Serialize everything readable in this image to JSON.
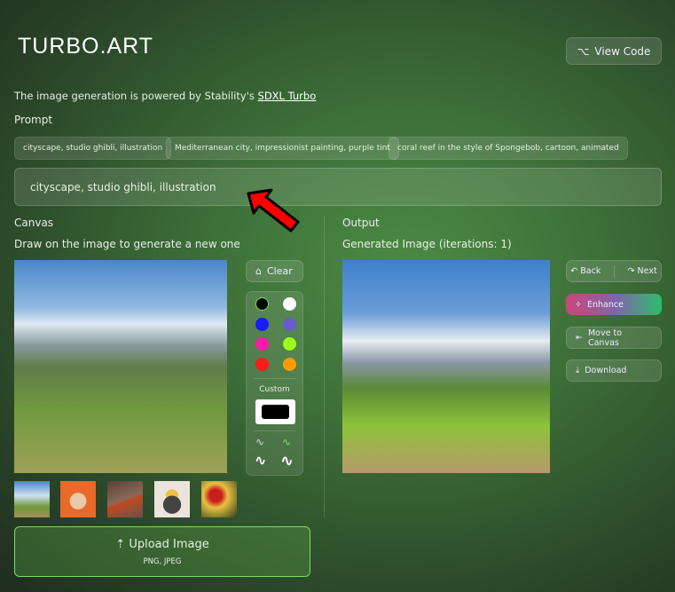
{
  "header": {
    "logo": "TURBO.ART",
    "view_code": "View Code"
  },
  "powered": {
    "text": "The image generation is powered by Stability's ",
    "link": "SDXL Turbo"
  },
  "prompt": {
    "label": "Prompt",
    "suggestions": [
      "cityscape, studio ghibli, illustration",
      "Mediterranean city, impressionist painting, purple tint",
      "coral reef in the style of Spongebob, cartoon, animated"
    ],
    "value": "cityscape, studio ghibli, illustration"
  },
  "canvas": {
    "title": "Canvas",
    "subtitle": "Draw on the image to generate a new one",
    "clear": "Clear",
    "colors": [
      "#000000",
      "#ffffff",
      "#1a1aff",
      "#6a5acd",
      "#ff1aa8",
      "#9aff1a",
      "#ff1a1a",
      "#ff9a00"
    ],
    "custom_label": "Custom",
    "custom_color": "#000000"
  },
  "output": {
    "title": "Output",
    "subtitle": "Generated Image (iterations: 1)",
    "back": "Back",
    "next": "Next",
    "enhance": "Enhance",
    "move": "Move to Canvas",
    "download": "Download"
  },
  "upload": {
    "label": "Upload Image",
    "formats": "PNG, JPEG"
  }
}
